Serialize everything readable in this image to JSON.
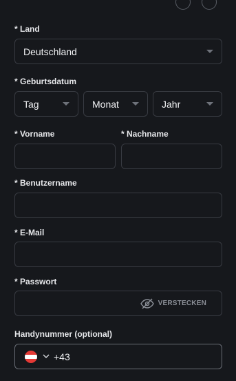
{
  "top_icons": [
    "circle-icon",
    "circle-icon"
  ],
  "country": {
    "label": "* Land",
    "value": "Deutschland"
  },
  "birthdate": {
    "label": "* Geburtsdatum",
    "day": "Tag",
    "month": "Monat",
    "year": "Jahr"
  },
  "first_name": {
    "label": "* Vorname",
    "value": ""
  },
  "last_name": {
    "label": "* Nachname",
    "value": ""
  },
  "username": {
    "label": "* Benutzername",
    "value": ""
  },
  "email": {
    "label": "* E-Mail",
    "value": ""
  },
  "password": {
    "label": "* Passwort",
    "value": "",
    "toggle_label": "VERSTECKEN",
    "toggle_icon": "eye-slash-icon"
  },
  "phone": {
    "label": "Handynummer (optional)",
    "flag_icon": "austria-flag-icon",
    "flag_colors": [
      "#e53935",
      "#ffffff",
      "#e53935"
    ],
    "prefix": "+43"
  }
}
